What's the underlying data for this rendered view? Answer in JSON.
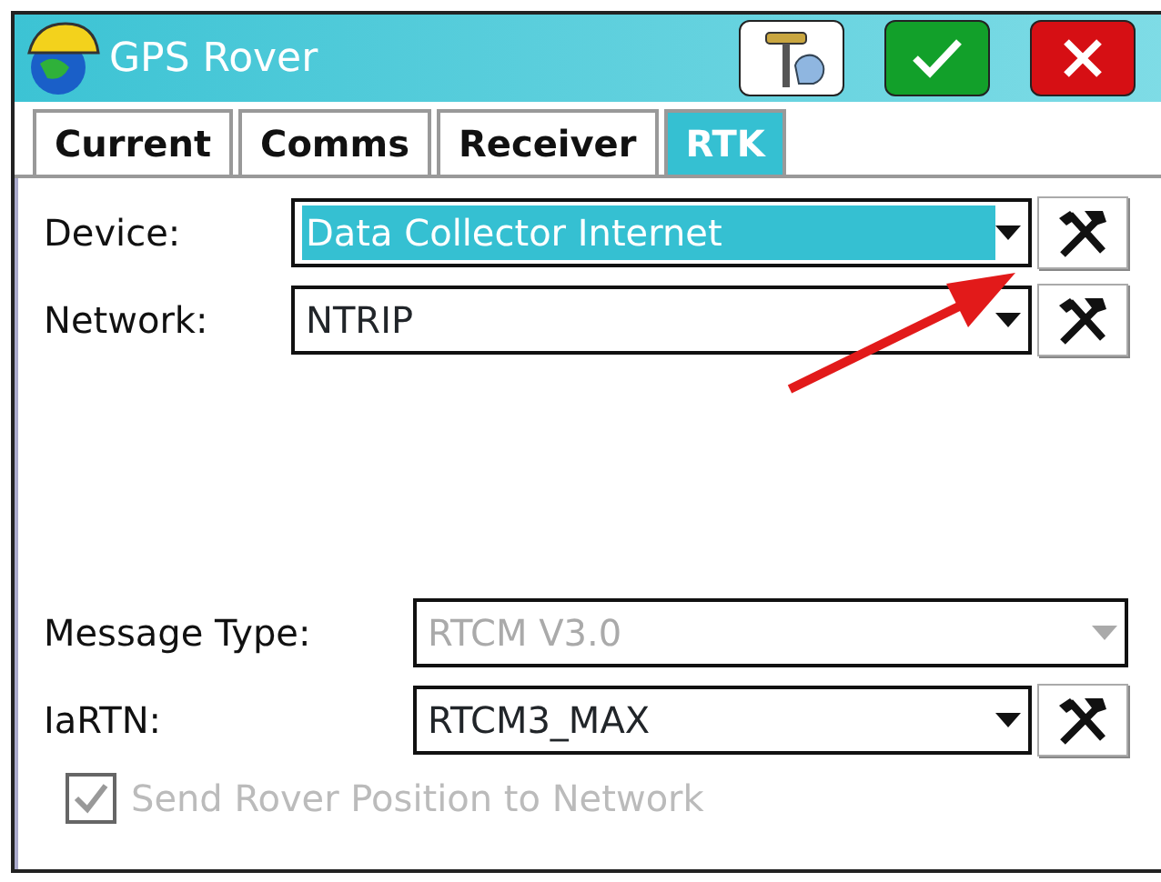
{
  "window": {
    "title": "GPS Rover"
  },
  "toolbar_buttons": [
    {
      "kind": "rover"
    },
    {
      "kind": "ok"
    },
    {
      "kind": "cancel"
    }
  ],
  "tabs": [
    {
      "label": "Current",
      "selected": false
    },
    {
      "label": "Comms",
      "selected": false
    },
    {
      "label": "Receiver",
      "selected": false
    },
    {
      "label": "RTK",
      "selected": true
    }
  ],
  "upper_fields": [
    {
      "label": "Device:",
      "value": "Data Collector Internet",
      "highlighted": true,
      "disabled": false,
      "tool_button": true
    },
    {
      "label": "Network:",
      "value": "NTRIP",
      "highlighted": false,
      "disabled": false,
      "tool_button": true
    }
  ],
  "lower_fields": [
    {
      "label": "Message Type:",
      "value": "RTCM V3.0",
      "highlighted": false,
      "disabled": true,
      "tool_button": false
    },
    {
      "label": "IaRTN:",
      "value": "RTCM3_MAX",
      "highlighted": false,
      "disabled": false,
      "tool_button": true
    }
  ],
  "checkbox": {
    "label": "Send Rover Position to Network",
    "checked": true,
    "disabled": true
  },
  "annotation_arrow": true
}
